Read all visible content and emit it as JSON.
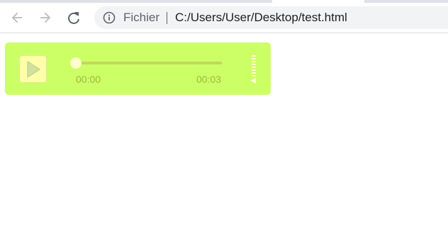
{
  "browser": {
    "nav": {
      "back_icon": "arrow-left-icon",
      "forward_icon": "arrow-right-icon",
      "reload_icon": "reload-icon"
    },
    "omnibox": {
      "info_icon": "info-icon",
      "chip_label": "Fichier",
      "url": "C:/Users/User/Desktop/test.html"
    }
  },
  "player": {
    "background": "#ccff66",
    "play_icon": "play-icon",
    "progress": 0,
    "current_time": "00:00",
    "duration": "00:03",
    "volume_icon": "volume-icon"
  }
}
